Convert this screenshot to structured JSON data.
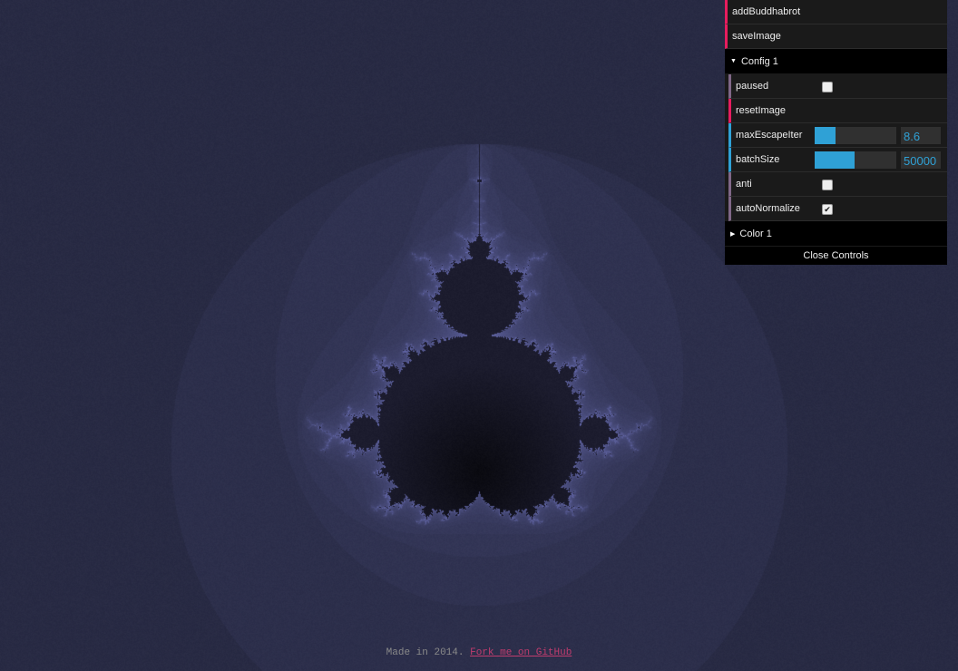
{
  "gui": {
    "top_buttons": [
      "addBuddhabrot",
      "saveImage"
    ],
    "config_folder": {
      "title": "Config 1",
      "paused_label": "paused",
      "paused_checked": false,
      "reset_label": "resetImage",
      "maxEscape": {
        "label": "maxEscapeIter",
        "value": "8.6",
        "fraction": 0.25
      },
      "batch": {
        "label": "batchSize",
        "value": "50000",
        "fraction": 0.49
      },
      "anti_label": "anti",
      "anti_checked": false,
      "auto_label": "autoNormalize",
      "auto_checked": true
    },
    "color_folder": {
      "title": "Color 1"
    },
    "close_label": "Close Controls",
    "colors": {
      "function": "#e61d5f",
      "boolean": "#806787",
      "number": "#2fa1d6"
    }
  },
  "footer": {
    "text": "Made in 2014.",
    "link": "Fork me on GitHub"
  },
  "icons": {
    "folder_open": "triangle-down-icon",
    "folder_closed": "triangle-right-icon",
    "check": "check-icon"
  }
}
